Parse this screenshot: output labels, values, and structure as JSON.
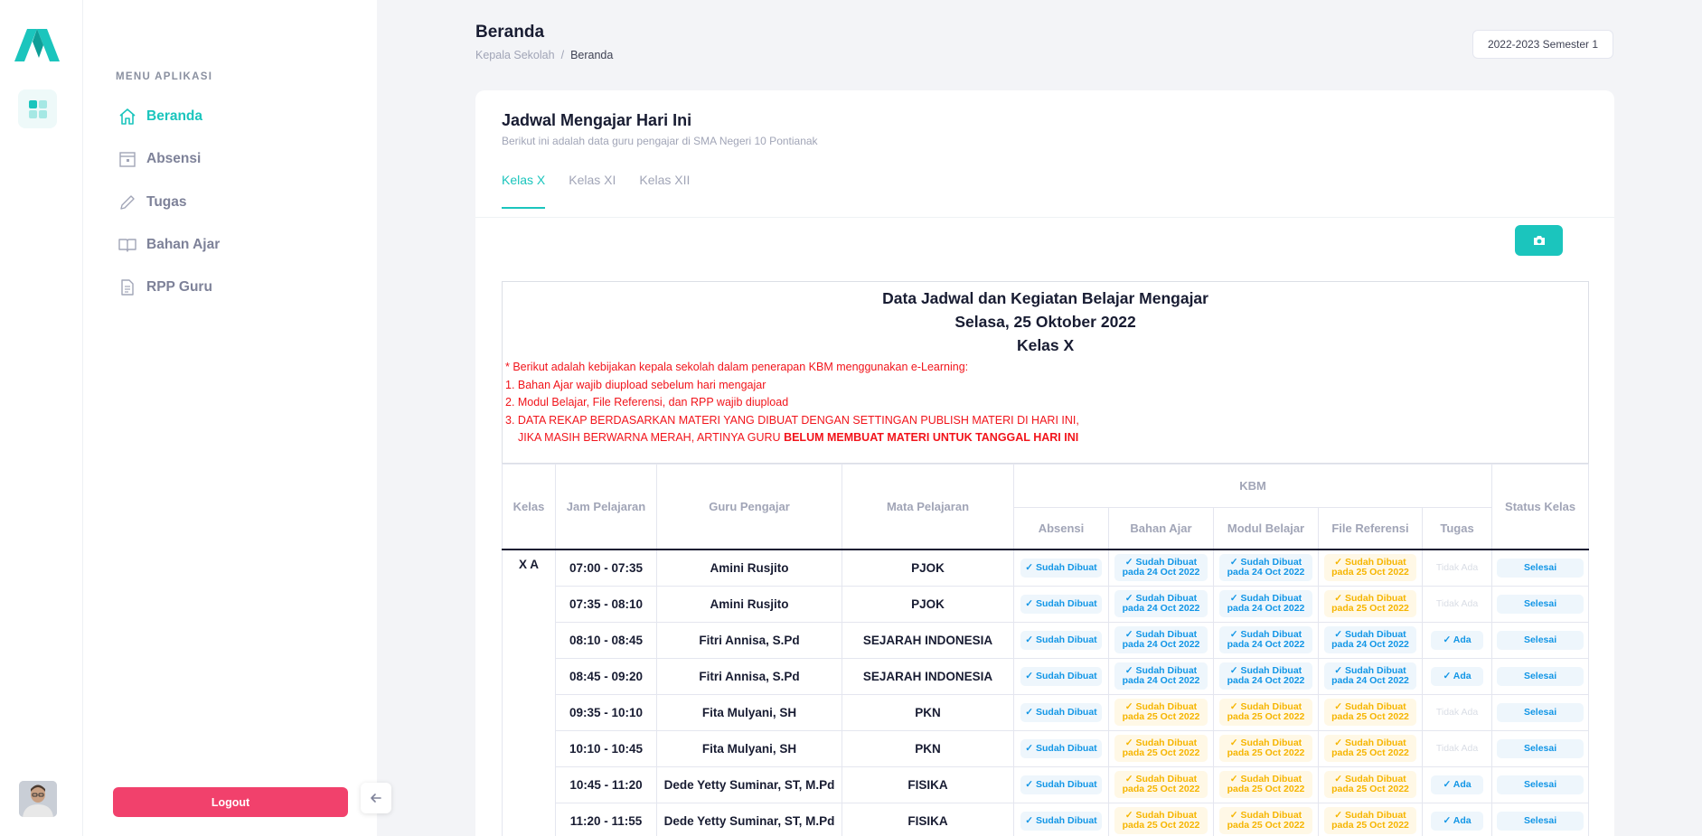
{
  "sidebar": {
    "menu_title": "MENU APLIKASI",
    "items": [
      {
        "label": "Beranda",
        "icon": "home-icon"
      },
      {
        "label": "Absensi",
        "icon": "calendar-icon"
      },
      {
        "label": "Tugas",
        "icon": "pencil-icon"
      },
      {
        "label": "Bahan Ajar",
        "icon": "book-icon"
      },
      {
        "label": "RPP Guru",
        "icon": "document-icon"
      }
    ],
    "logout_label": "Logout"
  },
  "header": {
    "title": "Beranda",
    "breadcrumb": [
      "Kepala Sekolah",
      "Beranda"
    ],
    "semester": "2022-2023 Semester 1"
  },
  "card": {
    "title": "Jadwal Mengajar Hari Ini",
    "subtitle": "Berikut ini adalah data guru pengajar di SMA Negeri 10 Pontianak",
    "tabs": [
      "Kelas X",
      "Kelas XI",
      "Kelas XII"
    ]
  },
  "report": {
    "heading_1": "Data Jadwal dan Kegiatan Belajar Mengajar",
    "heading_2": "Selasa, 25 Oktober 2022",
    "heading_3": "Kelas X",
    "note_intro": "* Berikut adalah kebijakan kepala sekolah dalam penerapan KBM menggunakan e-Learning:",
    "note_1": "1. Bahan Ajar wajib diupload sebelum hari mengajar",
    "note_2": "2. Modul Belajar, File Referensi, dan RPP wajib diupload",
    "note_3": "3. DATA REKAP BERDASARKAN MATERI YANG DIBUAT DENGAN SETTINGAN PUBLISH MATERI DI HARI INI,",
    "note_4": "JIKA MASIH BERWARNA MERAH, ARTINYA GURU",
    "note_4_bold": "BELUM MEMBUAT MATERI UNTUK TANGGAL HARI INI"
  },
  "table": {
    "headers": {
      "kelas": "Kelas",
      "jam": "Jam Pelajaran",
      "guru": "Guru Pengajar",
      "mapel": "Mata Pelajaran",
      "kbm": "KBM",
      "absensi": "Absensi",
      "bahan": "Bahan Ajar",
      "modul": "Modul Belajar",
      "file": "File Referensi",
      "tugas": "Tugas",
      "status": "Status Kelas"
    },
    "kelas": "X A",
    "rows": [
      {
        "jam": "07:00 - 07:35",
        "guru": "Amini Rusjito",
        "mapel": "PJOK",
        "absensi": "✓ Sudah Dibuat",
        "bahan_1": "✓ Sudah Dibuat",
        "bahan_2": "pada 24 Oct 2022",
        "bahan_c": "blue",
        "modul_1": "✓ Sudah Dibuat",
        "modul_2": "pada 24 Oct 2022",
        "modul_c": "blue",
        "file_1": "✓ Sudah Dibuat",
        "file_2": "pada 25 Oct 2022",
        "file_c": "orange",
        "tugas": "Tidak Ada",
        "tugas_c": "grey",
        "status": "Selesai"
      },
      {
        "jam": "07:35 - 08:10",
        "guru": "Amini Rusjito",
        "mapel": "PJOK",
        "absensi": "✓ Sudah Dibuat",
        "bahan_1": "✓ Sudah Dibuat",
        "bahan_2": "pada 24 Oct 2022",
        "bahan_c": "blue",
        "modul_1": "✓ Sudah Dibuat",
        "modul_2": "pada 24 Oct 2022",
        "modul_c": "blue",
        "file_1": "✓ Sudah Dibuat",
        "file_2": "pada 25 Oct 2022",
        "file_c": "orange",
        "tugas": "Tidak Ada",
        "tugas_c": "grey",
        "status": "Selesai"
      },
      {
        "jam": "08:10 - 08:45",
        "guru": "Fitri Annisa, S.Pd",
        "mapel": "SEJARAH INDONESIA",
        "absensi": "✓ Sudah Dibuat",
        "bahan_1": "✓ Sudah Dibuat",
        "bahan_2": "pada 24 Oct 2022",
        "bahan_c": "blue",
        "modul_1": "✓ Sudah Dibuat",
        "modul_2": "pada 24 Oct 2022",
        "modul_c": "blue",
        "file_1": "✓ Sudah Dibuat",
        "file_2": "pada 24 Oct 2022",
        "file_c": "blue",
        "tugas": "✓ Ada",
        "tugas_c": "blue",
        "status": "Selesai"
      },
      {
        "jam": "08:45 - 09:20",
        "guru": "Fitri Annisa, S.Pd",
        "mapel": "SEJARAH INDONESIA",
        "absensi": "✓ Sudah Dibuat",
        "bahan_1": "✓ Sudah Dibuat",
        "bahan_2": "pada 24 Oct 2022",
        "bahan_c": "blue",
        "modul_1": "✓ Sudah Dibuat",
        "modul_2": "pada 24 Oct 2022",
        "modul_c": "blue",
        "file_1": "✓ Sudah Dibuat",
        "file_2": "pada 24 Oct 2022",
        "file_c": "blue",
        "tugas": "✓ Ada",
        "tugas_c": "blue",
        "status": "Selesai"
      },
      {
        "jam": "09:35 - 10:10",
        "guru": "Fita Mulyani, SH",
        "mapel": "PKN",
        "absensi": "✓ Sudah Dibuat",
        "bahan_1": "✓ Sudah Dibuat",
        "bahan_2": "pada 25 Oct 2022",
        "bahan_c": "orange",
        "modul_1": "✓ Sudah Dibuat",
        "modul_2": "pada 25 Oct 2022",
        "modul_c": "orange",
        "file_1": "✓ Sudah Dibuat",
        "file_2": "pada 25 Oct 2022",
        "file_c": "orange",
        "tugas": "Tidak Ada",
        "tugas_c": "grey",
        "status": "Selesai"
      },
      {
        "jam": "10:10 - 10:45",
        "guru": "Fita Mulyani, SH",
        "mapel": "PKN",
        "absensi": "✓ Sudah Dibuat",
        "bahan_1": "✓ Sudah Dibuat",
        "bahan_2": "pada 25 Oct 2022",
        "bahan_c": "orange",
        "modul_1": "✓ Sudah Dibuat",
        "modul_2": "pada 25 Oct 2022",
        "modul_c": "orange",
        "file_1": "✓ Sudah Dibuat",
        "file_2": "pada 25 Oct 2022",
        "file_c": "orange",
        "tugas": "Tidak Ada",
        "tugas_c": "grey",
        "status": "Selesai"
      },
      {
        "jam": "10:45 - 11:20",
        "guru": "Dede Yetty Suminar, ST, M.Pd",
        "mapel": "FISIKA",
        "absensi": "✓ Sudah Dibuat",
        "bahan_1": "✓ Sudah Dibuat",
        "bahan_2": "pada 25 Oct 2022",
        "bahan_c": "orange",
        "modul_1": "✓ Sudah Dibuat",
        "modul_2": "pada 25 Oct 2022",
        "modul_c": "orange",
        "file_1": "✓ Sudah Dibuat",
        "file_2": "pada 25 Oct 2022",
        "file_c": "orange",
        "tugas": "✓ Ada",
        "tugas_c": "blue",
        "status": "Selesai"
      },
      {
        "jam": "11:20 - 11:55",
        "guru": "Dede Yetty Suminar, ST, M.Pd",
        "mapel": "FISIKA",
        "absensi": "✓ Sudah Dibuat",
        "bahan_1": "✓ Sudah Dibuat",
        "bahan_2": "pada 25 Oct 2022",
        "bahan_c": "orange",
        "modul_1": "✓ Sudah Dibuat",
        "modul_2": "pada 25 Oct 2022",
        "modul_c": "orange",
        "file_1": "✓ Sudah Dibuat",
        "file_2": "pada 25 Oct 2022",
        "file_c": "orange",
        "tugas": "✓ Ada",
        "tugas_c": "blue",
        "status": "Selesai"
      }
    ]
  },
  "colors": {
    "accent": "#1bc5bd",
    "danger": "#f1416c",
    "blue_badge": "#1296e6",
    "orange_badge": "#f6b500",
    "note_red": "#f1141b"
  }
}
